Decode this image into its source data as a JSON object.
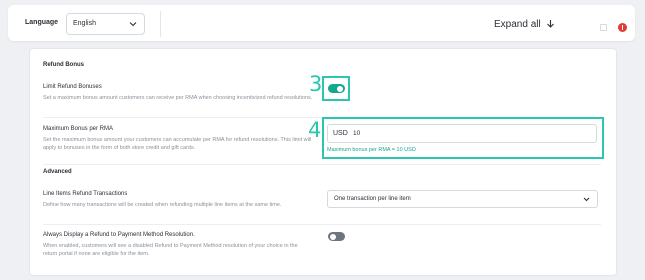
{
  "header": {
    "language_label": "Language",
    "language_value": "English",
    "expand_all_label": "Expand all"
  },
  "refund_bonus": {
    "section_title": "Refund Bonus",
    "limit": {
      "title": "Limit Refund Bonuses",
      "description": "Set a maximum bonus amount customers can receive per RMA when choosing incentivized refund resolutions.",
      "enabled": true
    },
    "maximum": {
      "title": "Maximum Bonus per RMA",
      "description": "Set the maximum bonus amount your customers can accumulate per RMA for refund resolutions. This limit will apply to bonuses in the form of both store credit and gift cards.",
      "currency": "USD",
      "value": "10",
      "hint": "Maximum bonus per RMA = 10 USD"
    }
  },
  "advanced": {
    "section_title": "Advanced",
    "line_items": {
      "title": "Line Items Refund Transactions",
      "description": "Define how many transactions will be created when refunding multiple line items at the same time.",
      "selected": "One transaction per line item"
    },
    "always_display": {
      "title": "Always Display a Refund to Payment Method Resolution.",
      "description": "When enabled, customers will see a disabled Refund to Payment Method resolution of your choice in the return portal if none are eligible for the item.",
      "enabled": false
    }
  },
  "callouts": {
    "toggle_step": "3",
    "input_step": "4"
  },
  "colors": {
    "accent": "#14a88c",
    "callout": "#2cc5ad",
    "alert": "#e53935"
  }
}
